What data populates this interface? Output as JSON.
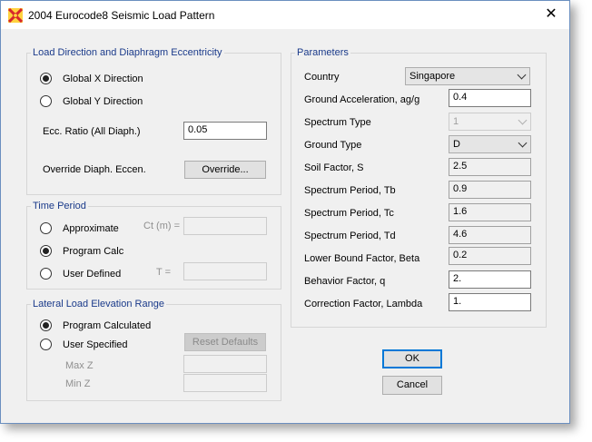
{
  "window": {
    "title": "2004 Eurocode8 Seismic Load Pattern",
    "close_glyph": "✕"
  },
  "load_direction": {
    "legend": "Load Direction and Diaphragm Eccentricity",
    "global_x_label": "Global  X  Direction",
    "global_y_label": "Global  Y  Direction",
    "ecc_ratio_label": "Ecc. Ratio (All Diaph.)",
    "ecc_ratio_value": "0.05",
    "override_label": "Override Diaph. Eccen.",
    "override_button": "Override..."
  },
  "time_period": {
    "legend": "Time Period",
    "approximate_label": "Approximate",
    "ct_label": "Ct (m) =",
    "program_calc_label": "Program Calc",
    "user_defined_label": "User Defined",
    "t_label": "T ="
  },
  "lateral_load": {
    "legend": "Lateral Load Elevation Range",
    "program_calculated_label": "Program Calculated",
    "user_specified_label": "User Specified",
    "reset_defaults_button": "Reset Defaults",
    "max_z_label": "Max Z",
    "min_z_label": "Min Z"
  },
  "parameters": {
    "legend": "Parameters",
    "country_label": "Country",
    "country_value": "Singapore",
    "ground_accel_label": "Ground Acceleration, ag/g",
    "ground_accel_value": "0.4",
    "spectrum_type_label": "Spectrum Type",
    "spectrum_type_value": "1",
    "ground_type_label": "Ground Type",
    "ground_type_value": "D",
    "soil_factor_label": "Soil Factor, S",
    "soil_factor_value": "2.5",
    "tb_label": "Spectrum Period, Tb",
    "tb_value": "0.9",
    "tc_label": "Spectrum Period, Tc",
    "tc_value": "1.6",
    "td_label": "Spectrum Period, Td",
    "td_value": "4.6",
    "beta_label": "Lower Bound Factor, Beta",
    "beta_value": "0.2",
    "q_label": "Behavior Factor, q",
    "q_value": "2.",
    "lambda_label": "Correction Factor, Lambda",
    "lambda_value": "1."
  },
  "buttons": {
    "ok": "OK",
    "cancel": "Cancel"
  }
}
